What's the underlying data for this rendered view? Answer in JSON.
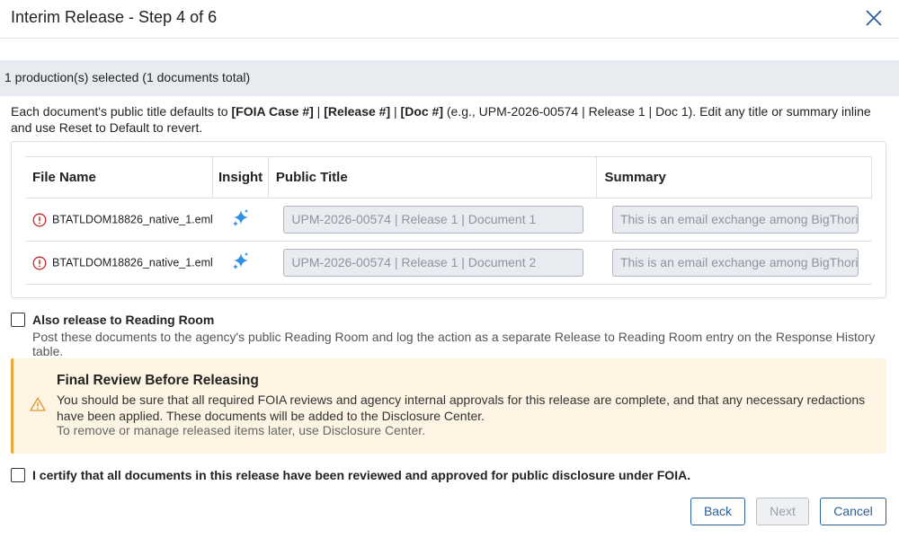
{
  "dialog": {
    "title": "Interim Release - Step 4 of 6"
  },
  "selection": {
    "summary": "1 production(s) selected (1 documents total)"
  },
  "description": {
    "part1": "Each document's public title defaults to ",
    "case": "[FOIA Case #]",
    "sep1": " | ",
    "release": "[Release #]",
    "sep2": " | ",
    "doc": "[Doc #]",
    "part2": " (e.g., UPM-2026-00574 | Release 1 | Doc 1). Edit any title or summary inline and use Reset to Default to revert."
  },
  "table": {
    "columns": [
      "File Name",
      "Insight",
      "Public Title",
      "Summary"
    ],
    "rows": [
      {
        "file_name": "BTATLDOM18826_native_1.eml",
        "public_title": "UPM-2026-00574 | Release 1 | Document 1",
        "summary": "This is an email exchange among BigThori"
      },
      {
        "file_name": "BTATLDOM18826_native_1.eml",
        "public_title": "UPM-2026-00574 | Release 1 | Document 2",
        "summary": "This is an email exchange among BigThori"
      }
    ]
  },
  "reading_room": {
    "label": "Also release to Reading Room",
    "description": "Post these documents to the agency's public Reading Room and log the action as a separate Release to Reading Room entry on the Response History table.",
    "checked": false
  },
  "warning": {
    "title": "Final Review Before Releasing",
    "body": "You should be sure that all required FOIA reviews and agency internal approvals for this release are complete, and that any necessary redactions have been applied. These documents will be added to the Disclosure Center.",
    "sub": "To remove or manage released items later, use Disclosure Center."
  },
  "certify": {
    "label": "I certify that all documents in this release have been reviewed and approved for public disclosure under FOIA.",
    "checked": false
  },
  "buttons": {
    "back": "Back",
    "next": "Next",
    "cancel": "Cancel"
  },
  "colors": {
    "accent": "#2b5f96",
    "error": "#c62828",
    "warning": "#e7a93a",
    "sparkle": "#2d8fe6"
  }
}
